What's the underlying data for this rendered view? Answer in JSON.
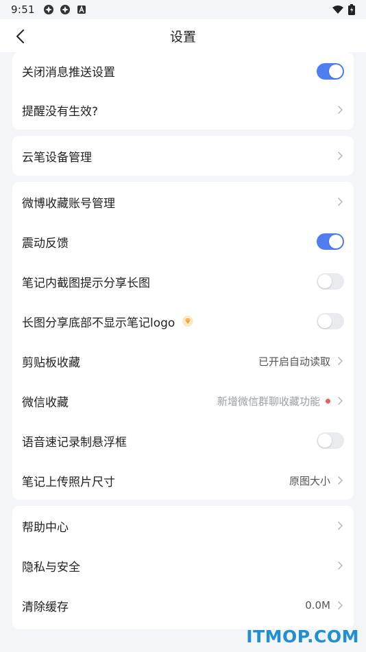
{
  "status_bar": {
    "time": "9:51",
    "left_icons": [
      "app-icon",
      "app-icon",
      "notification-icon"
    ],
    "right_icons": [
      "wifi-icon",
      "battery-icon"
    ]
  },
  "header": {
    "title": "设置",
    "back_icon": "chevron-left-icon"
  },
  "colors": {
    "accent": "#4f7df2",
    "background": "#f4f5f8",
    "card": "#ffffff",
    "badge_dot": "#f05a5a",
    "watermark": "#1f8fd6"
  },
  "group1": {
    "push_off": {
      "label": "关闭消息推送设置",
      "toggle": "on"
    },
    "reminder": {
      "label": "提醒没有生效?"
    }
  },
  "group2": {
    "pen_devices": {
      "label": "云笔设备管理"
    }
  },
  "group3": {
    "weibo": {
      "label": "微博收藏账号管理"
    },
    "vibration": {
      "label": "震动反馈",
      "toggle": "on"
    },
    "screenshot_share": {
      "label": "笔记内截图提示分享长图",
      "toggle": "off"
    },
    "hide_logo": {
      "label": "长图分享底部不显示笔记logo",
      "toggle": "off",
      "badge_icon": "vip-diamond-icon"
    },
    "clipboard": {
      "label": "剪贴板收藏",
      "value": "已开启自动读取"
    },
    "wechat": {
      "label": "微信收藏",
      "value": "新增微信群聊收藏功能"
    },
    "voice_float": {
      "label": "语音速记录制悬浮框",
      "toggle": "off"
    },
    "photo_size": {
      "label": "笔记上传照片尺寸",
      "value": "原图大小"
    }
  },
  "group4": {
    "help": {
      "label": "帮助中心"
    },
    "privacy": {
      "label": "隐私与安全"
    },
    "cache": {
      "label": "清除缓存",
      "value": "0.0M"
    }
  },
  "watermark": {
    "text": "ITMOP.COM"
  }
}
